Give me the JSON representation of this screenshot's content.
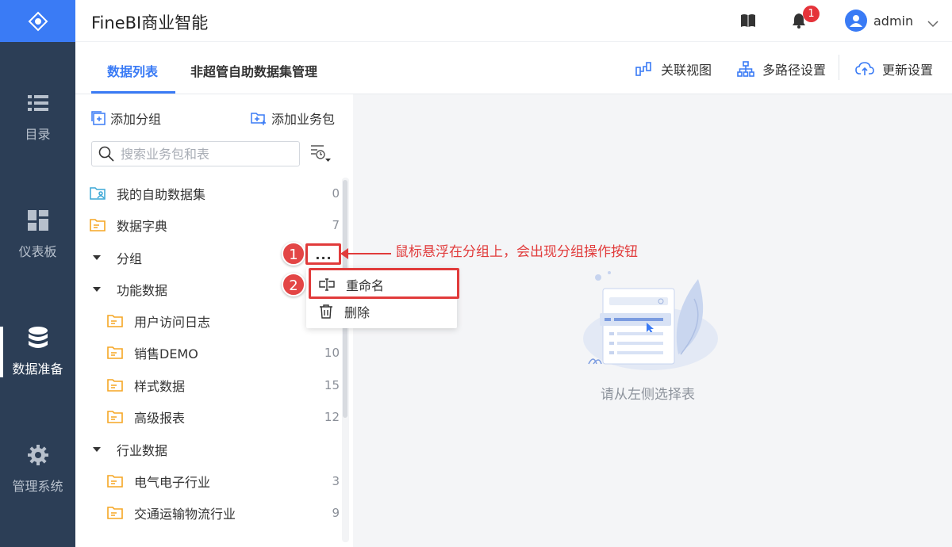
{
  "app": {
    "title": "FineBI商业智能"
  },
  "header": {
    "notification_count": "1",
    "user_name": "admin"
  },
  "nav": {
    "items": [
      {
        "label": "目录",
        "icon": "list-icon"
      },
      {
        "label": "仪表板",
        "icon": "dashboard-icon"
      },
      {
        "label": "数据准备",
        "icon": "database-icon"
      },
      {
        "label": "管理系统",
        "icon": "gear-icon"
      }
    ],
    "active": "数据准备"
  },
  "tabs": [
    {
      "label": "数据列表"
    },
    {
      "label": "非超管自助数据集管理"
    }
  ],
  "toolbar": {
    "relation_view": "关联视图",
    "multipath": "多路径设置",
    "update_settings": "更新设置"
  },
  "panel": {
    "add_group": "添加分组",
    "add_package": "添加业务包",
    "search_placeholder": "搜索业务包和表"
  },
  "tree": [
    {
      "label": "我的自助数据集",
      "count": "0"
    },
    {
      "label": "数据字典",
      "count": "7"
    },
    {
      "label": "分组"
    },
    {
      "label": "功能数据"
    },
    {
      "label": "用户访问日志"
    },
    {
      "label": "销售DEMO",
      "count": "10"
    },
    {
      "label": "样式数据",
      "count": "15"
    },
    {
      "label": "高级报表",
      "count": "12"
    },
    {
      "label": "行业数据"
    },
    {
      "label": "电气电子行业",
      "count": "3"
    },
    {
      "label": "交通运输物流行业",
      "count": "9"
    }
  ],
  "more_button": "...",
  "context_menu": {
    "rename": "重命名",
    "delete": "删除"
  },
  "empty_state": {
    "text": "请从左侧选择表"
  },
  "annotation": {
    "step1": "1",
    "step2": "2",
    "text": "鼠标悬浮在分组上，会出现分组操作按钮"
  },
  "colors": {
    "accent": "#3a7bf5",
    "nav_bg": "#2c3e56",
    "annotation": "#e13b3b",
    "folder": "#f5a623"
  }
}
